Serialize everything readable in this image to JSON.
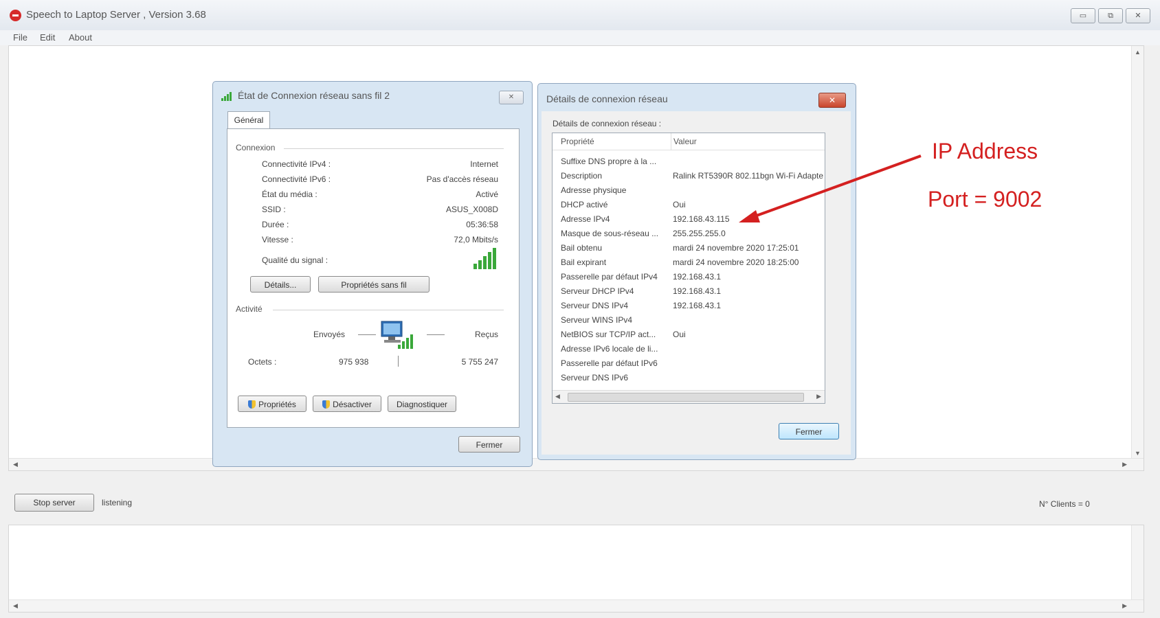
{
  "window": {
    "title": "Speech to Laptop Server , Version 3.68",
    "buttons": [
      "▭",
      "⧉",
      "✕"
    ]
  },
  "menu": [
    "File",
    "Edit",
    "About"
  ],
  "status_dialog": {
    "title": "État de Connexion réseau sans fil 2",
    "close": "✕",
    "tab": "Général",
    "connexion_label": "Connexion",
    "fields": [
      {
        "label": "Connectivité IPv4 :",
        "value": "Internet"
      },
      {
        "label": "Connectivité IPv6 :",
        "value": "Pas d'accès réseau"
      },
      {
        "label": "État du média :",
        "value": "Activé"
      },
      {
        "label": "SSID :",
        "value": "ASUS_X008D"
      },
      {
        "label": "Durée :",
        "value": "05:36:58"
      },
      {
        "label": "Vitesse :",
        "value": "72,0 Mbits/s"
      }
    ],
    "signal_label": "Qualité du signal :",
    "details_btn": "Détails...",
    "wireless_props_btn": "Propriétés sans fil",
    "activite_label": "Activité",
    "sent_label": "Envoyés",
    "received_label": "Reçus",
    "octets_label": "Octets :",
    "octets_sent": "975 938",
    "octets_received": "5 755 247",
    "props_btn": "Propriétés",
    "disable_btn": "Désactiver",
    "diag_btn": "Diagnostiquer",
    "close_btn": "Fermer"
  },
  "details_dialog": {
    "title": "Détails de connexion réseau",
    "close": "✕",
    "subtitle": "Détails de connexion réseau :",
    "col_prop": "Propriété",
    "col_val": "Valeur",
    "rows": [
      {
        "p": "Suffixe DNS propre à la ...",
        "v": ""
      },
      {
        "p": "Description",
        "v": "Ralink RT5390R 802.11bgn Wi-Fi Adapte"
      },
      {
        "p": "Adresse physique",
        "v": ""
      },
      {
        "p": "DHCP activé",
        "v": "Oui"
      },
      {
        "p": "Adresse IPv4",
        "v": "192.168.43.115"
      },
      {
        "p": "Masque de sous-réseau ...",
        "v": "255.255.255.0"
      },
      {
        "p": "Bail obtenu",
        "v": "mardi 24 novembre 2020 17:25:01"
      },
      {
        "p": "Bail expirant",
        "v": "mardi 24 novembre 2020 18:25:00"
      },
      {
        "p": "Passerelle par défaut IPv4",
        "v": "192.168.43.1"
      },
      {
        "p": "Serveur DHCP IPv4",
        "v": "192.168.43.1"
      },
      {
        "p": "Serveur DNS IPv4",
        "v": "192.168.43.1"
      },
      {
        "p": "Serveur WINS IPv4",
        "v": ""
      },
      {
        "p": "NetBIOS sur TCP/IP act...",
        "v": "Oui"
      },
      {
        "p": "Adresse IPv6 locale de li...",
        "v": ""
      },
      {
        "p": "Passerelle par défaut IPv6",
        "v": ""
      },
      {
        "p": "Serveur DNS IPv6",
        "v": ""
      }
    ],
    "close_btn": "Fermer"
  },
  "annotation": {
    "ip": "IP Address",
    "port": "Port = 9002",
    "color": "#d42020"
  },
  "server": {
    "stop_btn": "Stop server",
    "status": "listening",
    "clients": "N° Clients = 0"
  }
}
